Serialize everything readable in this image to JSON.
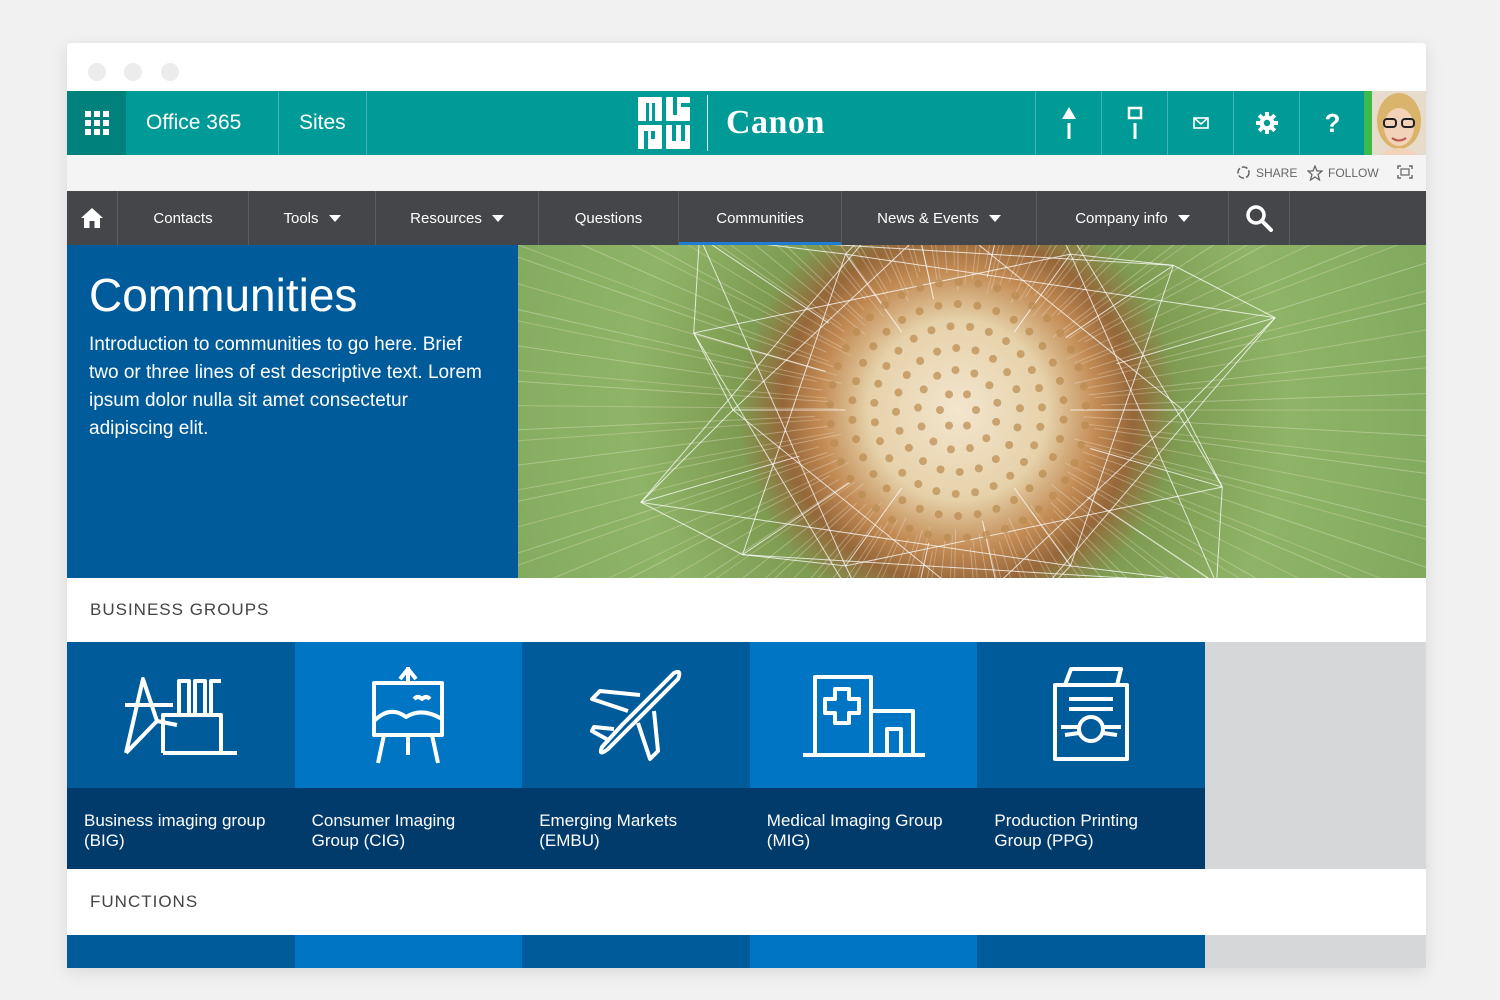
{
  "suite_bar": {
    "app_name": "Office 365",
    "sites_label": "Sites",
    "brand_name": "Canon",
    "bg_color": "#009b96",
    "icons": [
      "waffle-icon",
      "mru-logo",
      "pin-icon",
      "flag-icon",
      "mail-icon",
      "gear-icon",
      "help-icon",
      "user-avatar"
    ],
    "help_glyph": "?"
  },
  "action_bar": {
    "share_label": "SHARE",
    "follow_label": "FOLLOW",
    "focus_icon": "focus-icon"
  },
  "nav": {
    "items": [
      {
        "label": "Contacts",
        "dropdown": false
      },
      {
        "label": "Tools",
        "dropdown": true
      },
      {
        "label": "Resources",
        "dropdown": true
      },
      {
        "label": "Questions",
        "dropdown": false
      },
      {
        "label": "Communities",
        "dropdown": false,
        "active": true
      },
      {
        "label": "News & Events",
        "dropdown": true
      },
      {
        "label": "Company info",
        "dropdown": true
      }
    ],
    "home_icon": "home-icon",
    "search_icon": "search-icon"
  },
  "hero": {
    "title": "Communities",
    "intro": "Introduction to communities to go here. Brief two or three lines of est descriptive text. Lorem ipsum dolor nulla sit amet consectetur adipiscing elit.",
    "image": "dandelion-seedhead-image"
  },
  "business_groups": {
    "heading": "BUSINESS GROUPS",
    "tiles": [
      {
        "label": "Business imaging group (BIG)",
        "icon": "factory-icon",
        "color": "#005b9a"
      },
      {
        "label": "Consumer Imaging Group (CIG)",
        "icon": "easel-icon",
        "color": "#0075c4"
      },
      {
        "label": "Emerging Markets (EMBU)",
        "icon": "airplane-icon",
        "color": "#005b9a"
      },
      {
        "label": "Medical Imaging Group (MIG)",
        "icon": "hospital-icon",
        "color": "#0075c4"
      },
      {
        "label": "Production Printing Group (PPG)",
        "icon": "printed-document-icon",
        "color": "#005b9a"
      }
    ]
  },
  "functions": {
    "heading": "FUNCTIONS"
  }
}
